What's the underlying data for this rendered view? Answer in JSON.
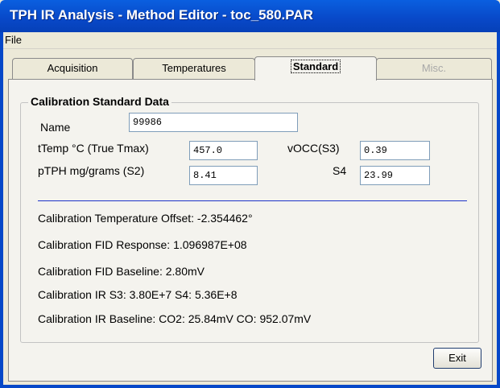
{
  "window": {
    "title": "TPH IR Analysis - Method Editor - toc_580.PAR"
  },
  "menu": {
    "file": "File"
  },
  "tabs": [
    {
      "label": "Acquisition"
    },
    {
      "label": "Temperatures"
    },
    {
      "label": "Standard"
    },
    {
      "label": "Misc."
    }
  ],
  "active_tab": "Standard",
  "calibration": {
    "group_title": "Calibration Standard Data",
    "name_label": "Name",
    "name_value": "99986",
    "ttemp_label": "tTemp °C (True Tmax)",
    "ttemp_value": "457.0",
    "ptph_label": "pTPH mg/grams (S2)",
    "ptph_value": "8.41",
    "vocc_label": "vOCC(S3)",
    "vocc_value": "0.39",
    "s4_label": "S4",
    "s4_value": "23.99"
  },
  "info_lines": [
    "Calibration Temperature Offset: -2.354462°",
    "Calibration FID Response: 1.096987E+08",
    "Calibration FID Baseline: 2.80mV",
    "Calibration IR S3: 3.80E+7 S4: 5.36E+8",
    "Calibration IR Baseline: CO2: 25.84mV CO: 952.07mV"
  ],
  "buttons": {
    "exit": "Exit"
  }
}
